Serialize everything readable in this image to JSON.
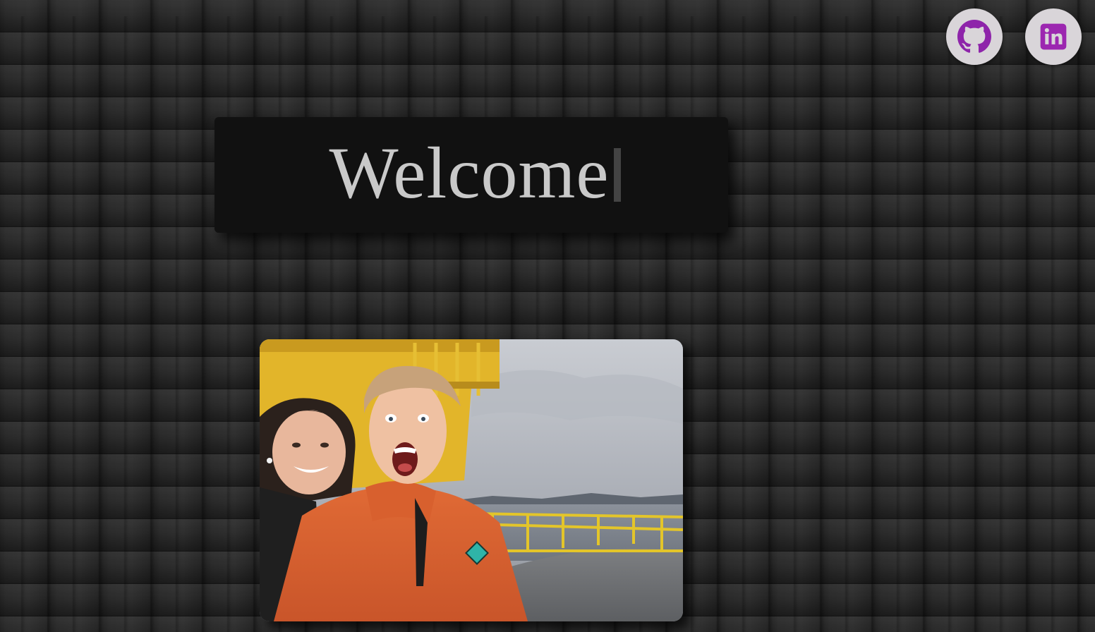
{
  "header": {
    "social_links": [
      {
        "name": "github",
        "icon": "github-icon",
        "color": "#8e24aa"
      },
      {
        "name": "linkedin",
        "icon": "linkedin-icon",
        "color": "#9c27b0"
      }
    ]
  },
  "hero": {
    "title": "Welcome"
  },
  "colors": {
    "background": "#2a2a2a",
    "title_box": "#111111",
    "title_text": "#c9c9c9",
    "social_bg": "#d9d5d9",
    "icon_purple": "#9c27b0"
  }
}
